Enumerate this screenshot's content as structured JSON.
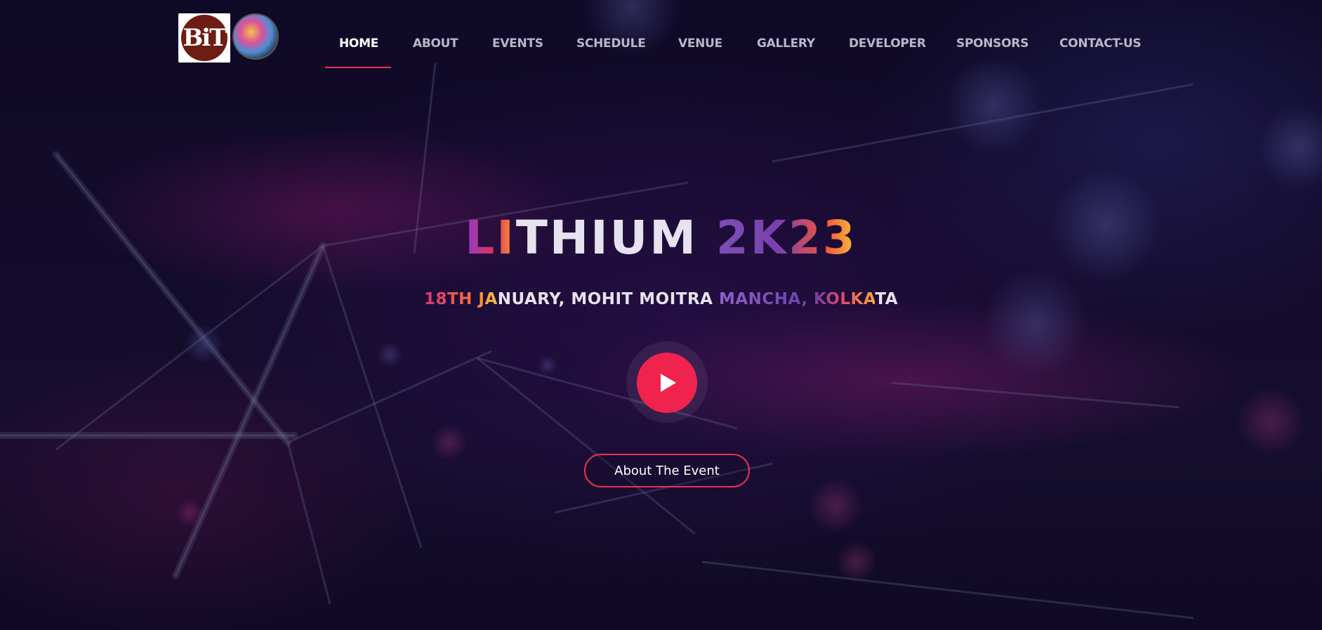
{
  "header": {
    "logos": [
      {
        "name": "BiT",
        "alt": "Bengal Institute of Technology"
      },
      {
        "name": "lithium-fest-logo"
      }
    ],
    "nav": [
      {
        "label": "HOME",
        "active": true
      },
      {
        "label": "ABOUT"
      },
      {
        "label": "EVENTS"
      },
      {
        "label": "SCHEDULE"
      },
      {
        "label": "VENUE"
      },
      {
        "label": "GALLERY"
      },
      {
        "label": "DEVELOPER"
      },
      {
        "label": "SPONSORS"
      },
      {
        "label": "CONTACT-US"
      }
    ]
  },
  "hero": {
    "title_parts": [
      "LI",
      "THIUM",
      " 2K23"
    ],
    "subtitle_parts": [
      "18TH JA",
      "NUARY, MOHIT MOITRA ",
      "MANCHA, KOLKA",
      "TA"
    ],
    "cta_label": "About The Event"
  },
  "colors": {
    "accent": "#f0234f",
    "nav_text": "#b9b6c8",
    "background": "#120c2a"
  },
  "icons": [
    "play-icon"
  ]
}
